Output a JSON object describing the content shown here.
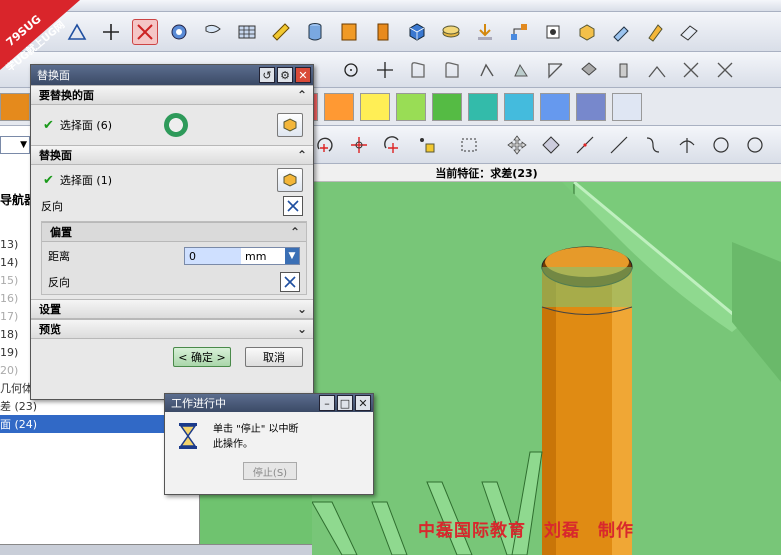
{
  "watermark": {
    "top": "79SUG",
    "bottom": "学UG就上UG网",
    "brand": "UG网"
  },
  "status": {
    "current_feature": "当前特征：求差(23)"
  },
  "colors": [
    "#e58a1c",
    "#f3d21a",
    "#4e7d24",
    "#1f74d1",
    "#7d2f8f",
    "#000000",
    "#808080",
    "#f0a8c8",
    "#ff6666",
    "#ff9933",
    "#ffee55",
    "#99dd55",
    "#55bb44",
    "#33bbaa",
    "#44bbdd",
    "#6699ee",
    "#7788cc",
    "#dfe6f3"
  ],
  "navigator": {
    "title": "导航器",
    "rows": [
      {
        "label": "13)",
        "dim": false
      },
      {
        "label": "14)",
        "dim": false
      },
      {
        "label": "15)",
        "dim": true
      },
      {
        "label": "16)",
        "dim": true
      },
      {
        "label": "17)",
        "dim": true
      },
      {
        "label": "18)",
        "dim": false
      },
      {
        "label": "19)",
        "dim": false
      },
      {
        "label": "20)",
        "dim": true
      },
      {
        "label": "几何体",
        "dim": false
      },
      {
        "label": "差 (23)",
        "dim": false
      },
      {
        "label": "面 (24)",
        "dim": false
      }
    ]
  },
  "dialog": {
    "title": "替换面",
    "section1": {
      "header": "要替换的面",
      "select_label": "选择面 (6)"
    },
    "section2": {
      "header": "替换面",
      "select_label": "选择面 (1)",
      "reverse_label": "反向"
    },
    "offset": {
      "header": "偏置",
      "distance_label": "距离",
      "distance_value": "0",
      "unit": "mm",
      "reverse_label": "反向"
    },
    "settings": "设置",
    "preview": "预览",
    "ok": "< 确定 >",
    "cancel": "取消"
  },
  "work_dialog": {
    "title": "工作进行中",
    "message_line1": "单击 \"停止\" 以中断",
    "message_line2": "此操作。",
    "stop": "停止(S)"
  },
  "credit": "中磊国际教育　刘磊　制作",
  "icons": {
    "toolbar2": [
      "sketch-icon",
      "plus-icon",
      "point-icon",
      "gear-shape-icon",
      "flag-icon",
      "mesh-icon",
      "ruler-icon",
      "cylinder-icon",
      "book-icon",
      "block-icon",
      "cube-icon",
      "layers-icon",
      "install-icon",
      "network-icon",
      "chip-icon",
      "box-icon",
      "arrow-icon",
      "pencil-icon",
      "eraser-icon"
    ],
    "toolbar3": [
      "circle-icon",
      "plus-icon",
      "spline-icon",
      "spline2-icon",
      "extrude-icon",
      "revolve-icon",
      "trim-icon",
      "project-icon",
      "offset-icon",
      "corner-icon",
      "mirror-icon",
      "split-icon",
      "chamfer-icon"
    ],
    "toolbar5": [
      "rotate-icon",
      "move-icon",
      "snap-icon",
      "select-box-icon",
      "transform-icon",
      "drag-icon",
      "line-icon",
      "diagonal-icon",
      "arc-icon",
      "cross-icon",
      "circle-icon",
      "circle-icon"
    ]
  }
}
